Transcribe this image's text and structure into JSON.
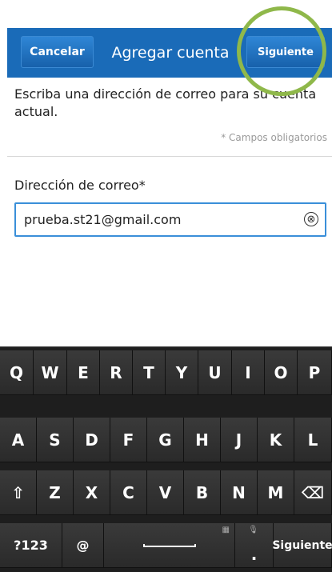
{
  "header": {
    "cancel_label": "Cancelar",
    "title": "Agregar cuenta",
    "next_label": "Siguiente"
  },
  "form": {
    "instructions": "Escriba una dirección de correo para su cuenta actual.",
    "required_note": "* Campos obligatorios",
    "email_label": "Dirección de correo*",
    "email_value": "prueba.st21@gmail.com",
    "clear_icon": "⊗"
  },
  "keyboard": {
    "row1": [
      "Q",
      "W",
      "E",
      "R",
      "T",
      "Y",
      "U",
      "I",
      "O",
      "P"
    ],
    "row2": [
      "A",
      "S",
      "D",
      "F",
      "G",
      "H",
      "J",
      "K",
      "L"
    ],
    "row3_shift": "⇧",
    "row3": [
      "Z",
      "X",
      "C",
      "V",
      "B",
      "N",
      "M"
    ],
    "row3_backspace": "⌫",
    "row4_symbols": "?123",
    "row4_at": "@",
    "row4_dot": ".",
    "row4_enter": "Siguiente"
  },
  "colors": {
    "header": "#1a6bb8",
    "highlight_ring": "#8fb84a",
    "field_border": "#3a8fd9"
  }
}
